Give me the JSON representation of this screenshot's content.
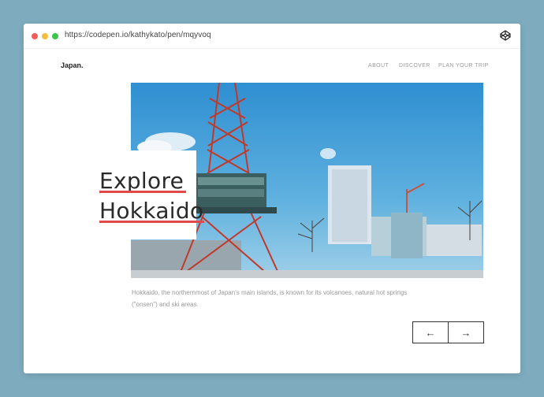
{
  "browser": {
    "url": "https://codepen.io/kathykato/pen/mqyvoq",
    "icon": "codepen-icon"
  },
  "site": {
    "brand": "Japan.",
    "nav": [
      "ABOUT",
      "DISCOVER",
      "PLAN YOUR TRIP"
    ]
  },
  "hero": {
    "title_line1": "Explore",
    "title_line2": "Hokkaido",
    "image": "sapporo-tv-tower-photo",
    "accent_color": "#e04a4a"
  },
  "description": "Hokkaido, the northernmost of Japan's main islands, is known for its volcanoes, natural hot springs (\"onsen\") and ski areas.",
  "controls": {
    "prev": "←",
    "next": "→"
  }
}
